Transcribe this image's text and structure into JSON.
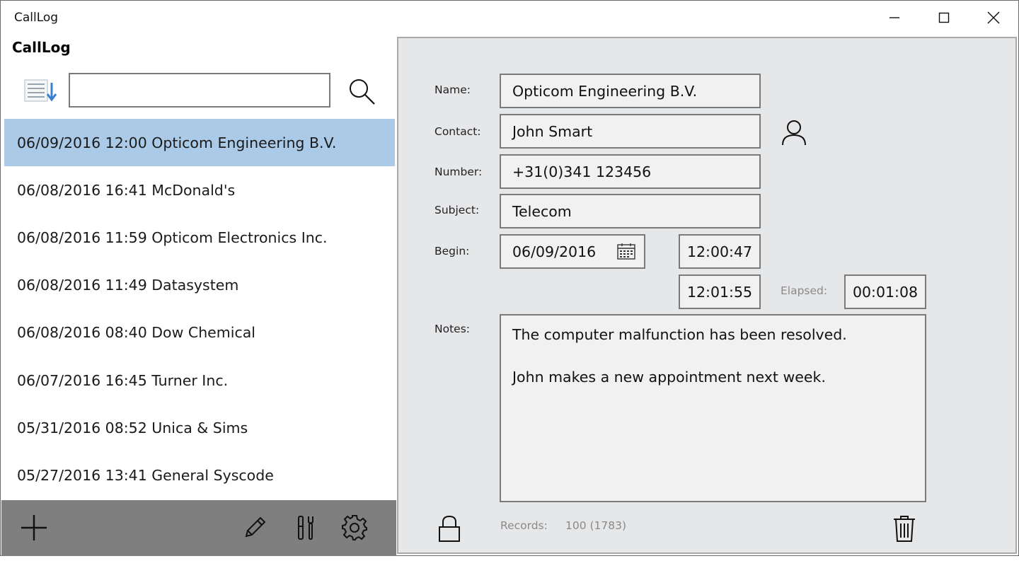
{
  "window": {
    "title": "CallLog"
  },
  "app": {
    "header": "CallLog"
  },
  "search": {
    "value": "",
    "placeholder": ""
  },
  "calls": [
    {
      "text": "06/09/2016 12:00 Opticom Engineering B.V.",
      "selected": true
    },
    {
      "text": "06/08/2016 16:41 McDonald's",
      "selected": false
    },
    {
      "text": "06/08/2016 11:59 Opticom Electronics Inc.",
      "selected": false
    },
    {
      "text": "06/08/2016 11:49 Datasystem",
      "selected": false
    },
    {
      "text": "06/08/2016 08:40 Dow Chemical",
      "selected": false
    },
    {
      "text": "06/07/2016 16:45 Turner Inc.",
      "selected": false
    },
    {
      "text": "05/31/2016 08:52 Unica & Sims",
      "selected": false
    },
    {
      "text": "05/27/2016 13:41 General Syscode",
      "selected": false
    }
  ],
  "detail": {
    "name_label": "Name:",
    "name": "Opticom Engineering B.V.",
    "contact_label": "Contact:",
    "contact": "John Smart",
    "number_label": "Number:",
    "number": "+31(0)341 123456",
    "subject_label": "Subject:",
    "subject": "Telecom",
    "begin_label": "Begin:",
    "begin_date": "06/09/2016",
    "begin_time": "12:00:47",
    "end_time": "12:01:55",
    "elapsed_label": "Elapsed:",
    "elapsed": "00:01:08",
    "notes_label": "Notes:",
    "notes_line1": "The computer malfunction has been resolved.",
    "notes_line2": "",
    "notes_line3": "John makes a new appointment next week.",
    "records_label": "Records:",
    "records_value": "100 (1783)"
  },
  "icons": {
    "sort": "sort-list-icon",
    "search": "search-icon",
    "add": "plus-icon",
    "edit": "pencil-icon",
    "tools": "tools-icon",
    "settings": "gear-icon",
    "contact": "person-icon",
    "calendar": "calendar-icon",
    "lock": "lock-icon",
    "delete": "trash-icon"
  },
  "colors": {
    "selected_row": "#aacae8",
    "toolbar": "#7f7f7f",
    "detail_background": "#e6e7e9",
    "field_background": "#f1f1f1"
  }
}
